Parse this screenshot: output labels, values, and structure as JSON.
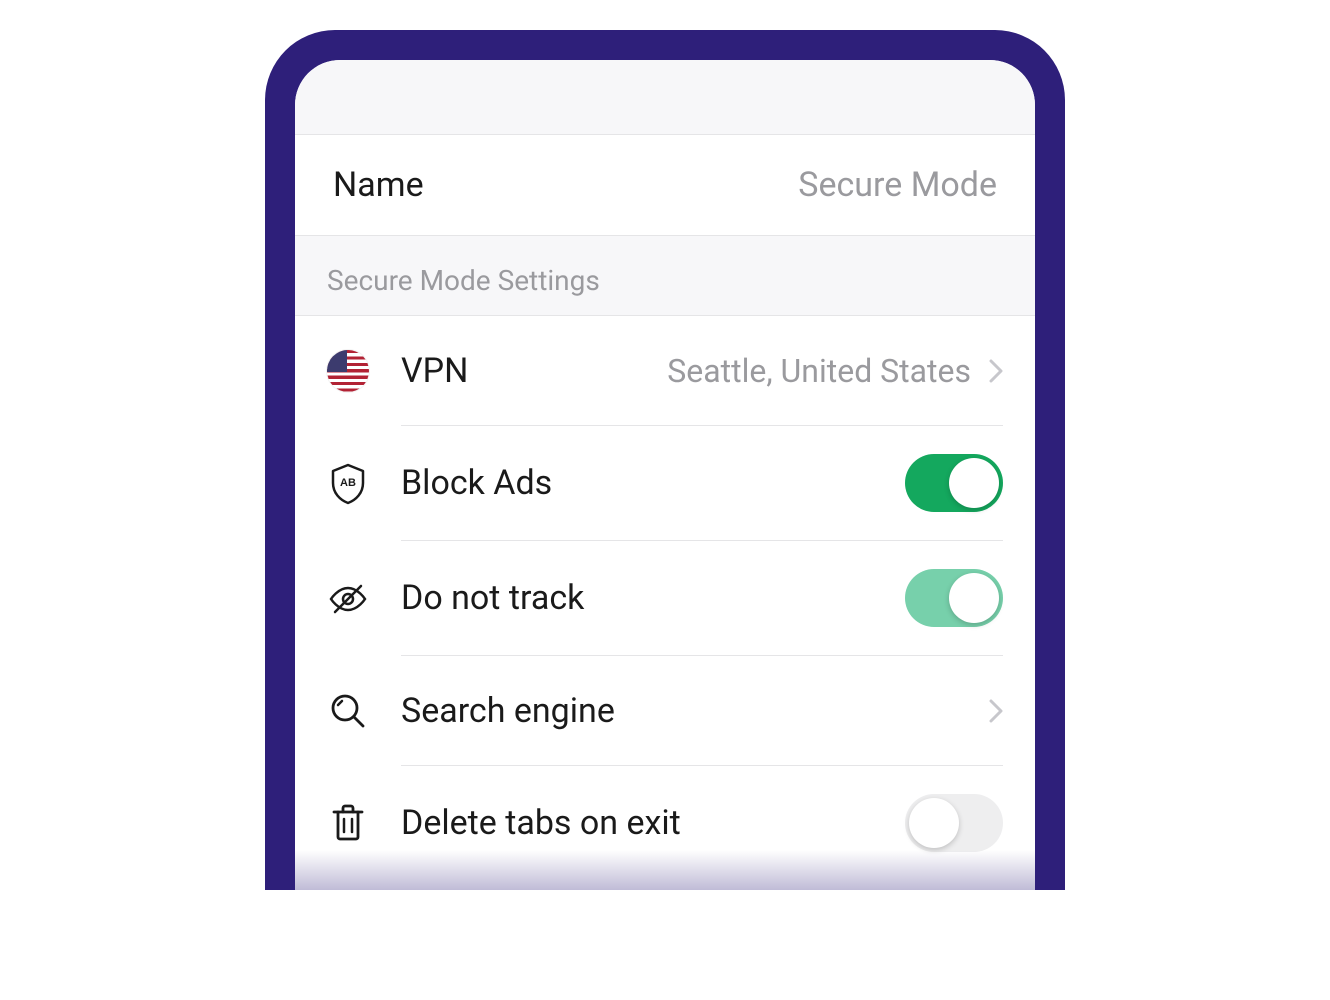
{
  "name_row": {
    "label": "Name",
    "value": "Secure Mode"
  },
  "section": {
    "title": "Secure Mode Settings"
  },
  "settings": {
    "vpn": {
      "label": "VPN",
      "value": "Seattle, United States"
    },
    "block_ads": {
      "label": "Block Ads",
      "enabled": true
    },
    "do_not_track": {
      "label": "Do not track",
      "enabled": true
    },
    "search_engine": {
      "label": "Search engine"
    },
    "delete_tabs": {
      "label": "Delete tabs on exit",
      "enabled": false
    }
  }
}
